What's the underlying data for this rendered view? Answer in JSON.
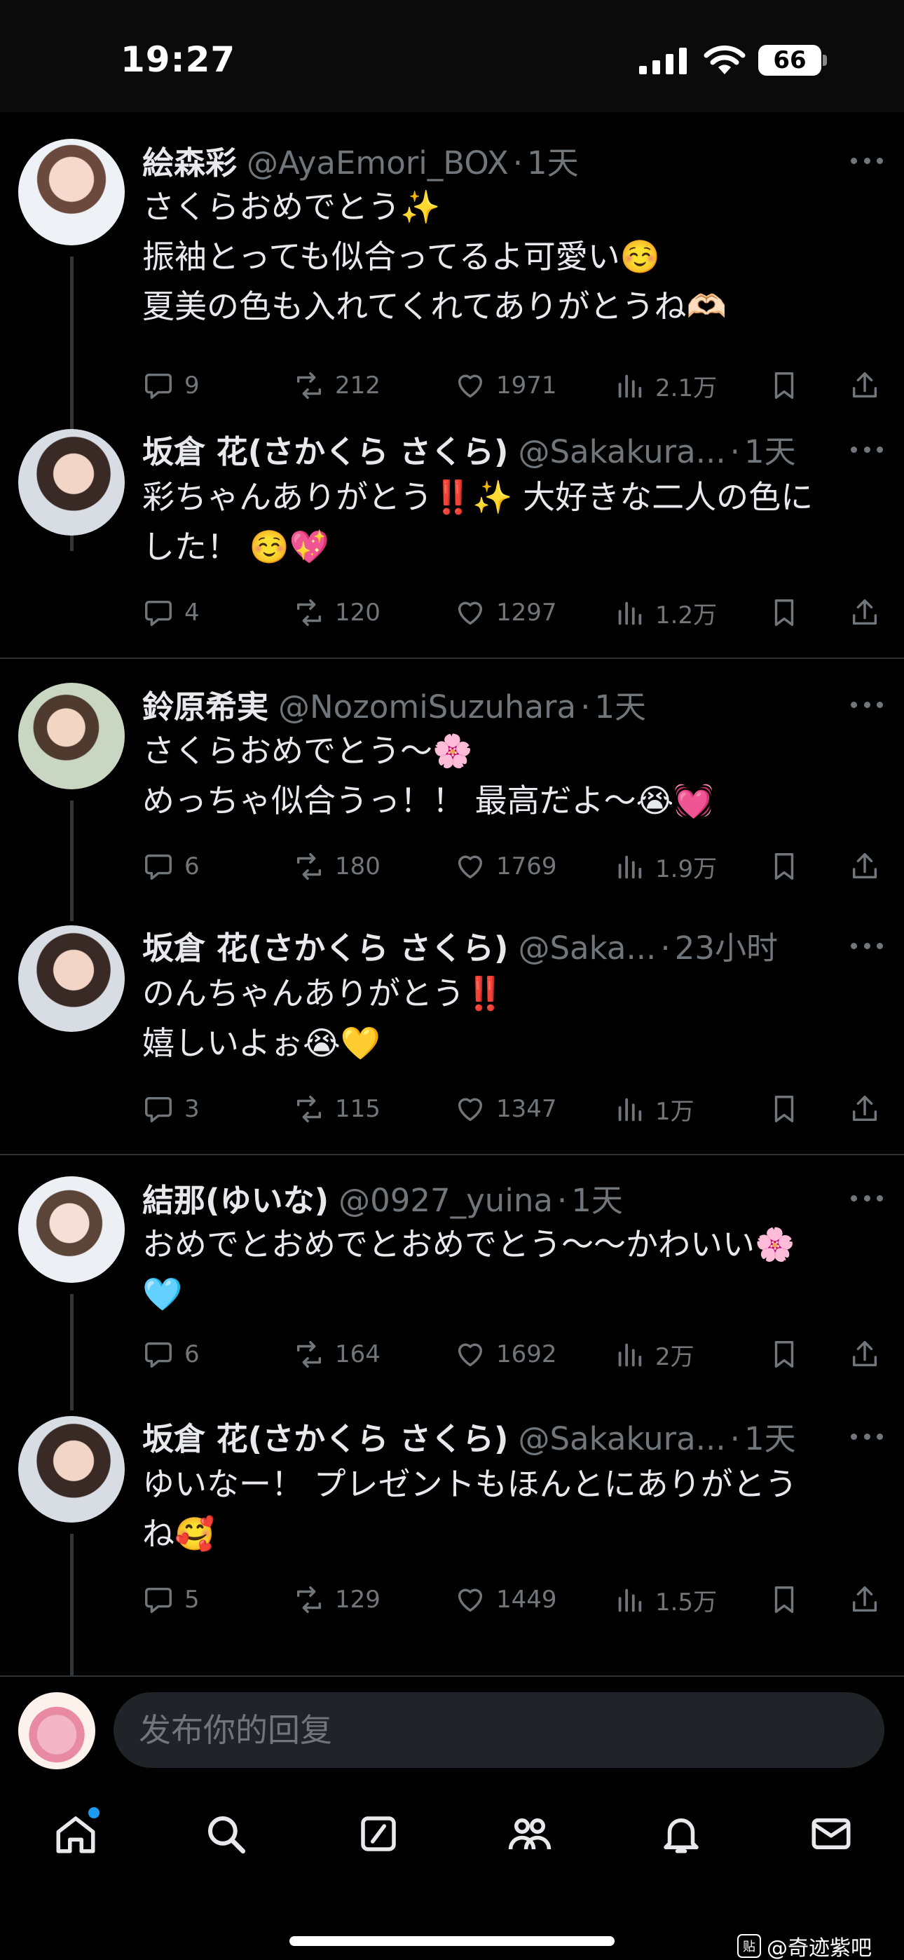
{
  "status_bar": {
    "time": "19:27",
    "battery": "66"
  },
  "tweets": [
    {
      "name": "絵森彩",
      "handle": "@AyaEmori_BOX",
      "time": "1天",
      "text": "さくらおめでとう✨\n振袖とっても似合ってるよ可愛い☺️\n夏美の色も入れてくれてありがとうね🫶🏻",
      "replies": "9",
      "retweets": "212",
      "likes": "1971",
      "views": "2.1万"
    },
    {
      "name": "坂倉 花(さかくら さくら)",
      "handle": "@Sakakura...",
      "time": "1天",
      "text": "彩ちゃんありがとう‼️✨ 大好きな二人の色に\nした！ ☺️💖",
      "replies": "4",
      "retweets": "120",
      "likes": "1297",
      "views": "1.2万"
    },
    {
      "name": "鈴原希実",
      "handle": "@NozomiSuzuhara",
      "time": "1天",
      "text": "さくらおめでとう〜🌸\nめっちゃ似合うっ！！ 最高だよ〜😭💓",
      "replies": "6",
      "retweets": "180",
      "likes": "1769",
      "views": "1.9万"
    },
    {
      "name": "坂倉 花(さかくら さくら)",
      "handle": "@Saka...",
      "time": "23小时",
      "text": "のんちゃんありがとう‼️\n嬉しいよぉ😭💛",
      "replies": "3",
      "retweets": "115",
      "likes": "1347",
      "views": "1万"
    },
    {
      "name": "結那(ゆいな)",
      "handle": "@0927_yuina",
      "time": "1天",
      "text": "おめでとおめでとおめでとう〜〜かわいい🌸\n🩵",
      "replies": "6",
      "retweets": "164",
      "likes": "1692",
      "views": "2万"
    },
    {
      "name": "坂倉 花(さかくら さくら)",
      "handle": "@Sakakura...",
      "time": "1天",
      "text": "ゆいなー！ プレゼントもほんとにありがとう\nね🥰",
      "replies": "5",
      "retweets": "129",
      "likes": "1449",
      "views": "1.5万"
    }
  ],
  "reply_bar": {
    "placeholder": "发布你的回复"
  },
  "watermark": {
    "icon": "贴",
    "text": "@奇迹紫吧"
  },
  "icons": {
    "reply": "speech-bubble-icon",
    "retweet": "retweet-icon",
    "like": "heart-icon",
    "views": "bar-chart-icon",
    "bookmark": "bookmark-icon",
    "share": "share-icon",
    "nav": [
      "home-icon",
      "search-icon",
      "grok-icon",
      "communities-icon",
      "notifications-icon",
      "messages-icon"
    ]
  },
  "colors": {
    "accent": "#1d9bf0",
    "muted": "#71767b",
    "text": "#e7e9ea",
    "background": "#000000"
  }
}
